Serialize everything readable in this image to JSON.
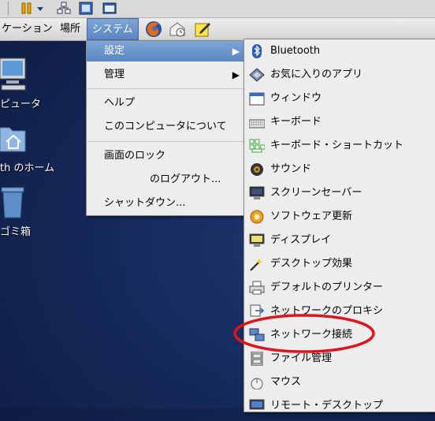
{
  "panel": {
    "menus": [
      "ケーション",
      "場所",
      "システム"
    ]
  },
  "desktop": {
    "icons": [
      {
        "label": "ピュータ"
      },
      {
        "label": "th のホーム"
      },
      {
        "label": "ゴミ箱"
      }
    ]
  },
  "system_menu": {
    "items": [
      {
        "label": "設定"
      },
      {
        "label": "管理"
      },
      {
        "label": "ヘルプ"
      },
      {
        "label": "このコンピュータについて"
      },
      {
        "label": "画面のロック"
      },
      {
        "label": "のログアウト..."
      },
      {
        "label": "シャットダウン..."
      }
    ]
  },
  "settings_submenu": {
    "items": [
      {
        "label": "Bluetooth",
        "icon": "bluetooth-icon"
      },
      {
        "label": "お気に入りのアプリ",
        "icon": "favorite-apps-icon"
      },
      {
        "label": "ウィンドウ",
        "icon": "window-icon"
      },
      {
        "label": "キーボード",
        "icon": "keyboard-icon"
      },
      {
        "label": "キーボード・ショートカット",
        "icon": "keyboard-shortcut-icon"
      },
      {
        "label": "サウンド",
        "icon": "sound-icon"
      },
      {
        "label": "スクリーンセーバー",
        "icon": "screensaver-icon"
      },
      {
        "label": "ソフトウェア更新",
        "icon": "software-update-icon"
      },
      {
        "label": "ディスプレイ",
        "icon": "display-icon"
      },
      {
        "label": "デスクトップ効果",
        "icon": "desktop-effects-icon"
      },
      {
        "label": "デフォルトのプリンター",
        "icon": "printer-icon"
      },
      {
        "label": "ネットワークのプロキシ",
        "icon": "network-proxy-icon"
      },
      {
        "label": "ネットワーク接続",
        "icon": "network-connections-icon"
      },
      {
        "label": "ファイル管理",
        "icon": "file-management-icon"
      },
      {
        "label": "マウス",
        "icon": "mouse-icon"
      },
      {
        "label": "リモート・デスクトップ",
        "icon": "remote-desktop-icon"
      }
    ]
  },
  "colors": {
    "highlight": "#6a93cb",
    "annotation": "#e0141e",
    "desktop": "#17295a"
  }
}
